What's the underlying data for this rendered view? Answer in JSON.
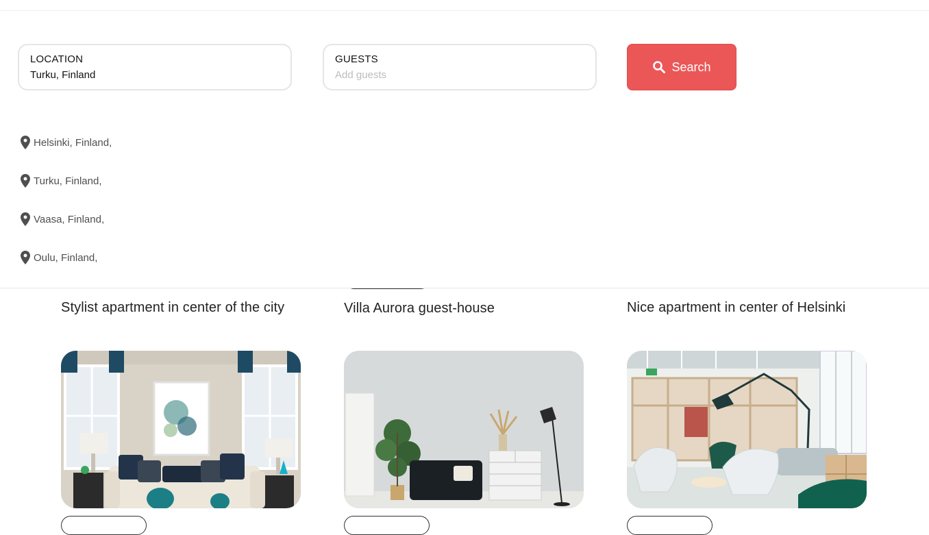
{
  "search": {
    "location": {
      "label": "LOCATION",
      "value": "Turku, Finland"
    },
    "guests": {
      "label": "GUESTS",
      "placeholder": "Add guests"
    },
    "button_label": "Search",
    "accent_color": "#eb5757",
    "search_icon": "search-icon"
  },
  "suggestions": [
    {
      "label": "Helsinki, Finland,",
      "icon": "map-pin-icon"
    },
    {
      "label": "Turku, Finland,",
      "icon": "map-pin-icon"
    },
    {
      "label": "Vaasa, Finland,",
      "icon": "map-pin-icon"
    },
    {
      "label": "Oulu, Finland,",
      "icon": "map-pin-icon"
    }
  ],
  "listings": [
    {
      "title": "Stylist apartment in center of the city"
    },
    {
      "title": "Villa Aurora guest-house"
    },
    {
      "title": "Nice apartment in center of Helsinki"
    }
  ]
}
